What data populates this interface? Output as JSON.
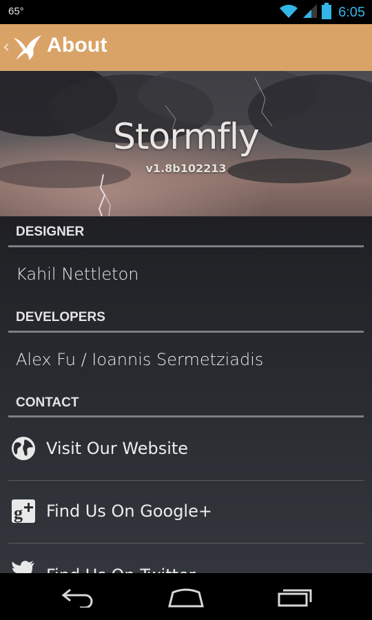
{
  "status_bar": {
    "temperature": "65°",
    "time": "6:05",
    "icons": [
      "wifi-icon",
      "signal-icon",
      "battery-icon"
    ],
    "time_color": "#33b5e5"
  },
  "action_bar": {
    "title": "About",
    "background_color": "#d9a367",
    "icons": [
      "back-chevron-icon",
      "stormfly-bird-logo-icon"
    ]
  },
  "hero": {
    "app_name": "Stormfly",
    "version": "v1.8b102213"
  },
  "sections": {
    "designer": {
      "header": "DESIGNER",
      "value": "Kahil Nettleton"
    },
    "developers": {
      "header": "DEVELOPERS",
      "value": "Alex Fu / Ioannis Sermetziadis"
    },
    "contact": {
      "header": "CONTACT",
      "links": [
        {
          "label": "Visit Our Website",
          "icon": "globe-icon"
        },
        {
          "label": "Find Us On Google+",
          "icon": "google-plus-icon"
        },
        {
          "label": "Find Us On Twitter",
          "icon": "twitter-bird-icon"
        }
      ]
    }
  },
  "nav_bar": {
    "icons": [
      "back-icon",
      "home-icon",
      "recent-apps-icon"
    ]
  }
}
